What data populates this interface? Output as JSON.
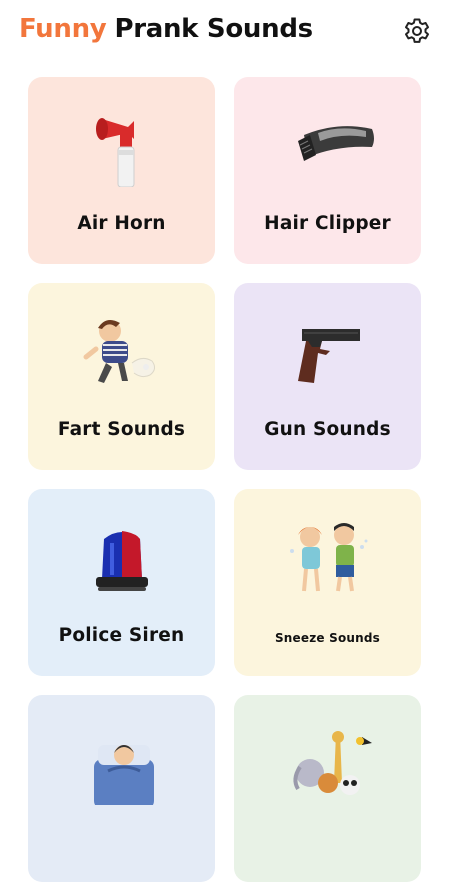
{
  "header": {
    "title_accent": "Funny",
    "title_rest": "Prank Sounds",
    "accent_color": "#f2763c",
    "settings_icon": "gear-icon"
  },
  "sounds": [
    {
      "label": "Air Horn",
      "icon": "air-horn-icon",
      "bg": "#fde5dc"
    },
    {
      "label": "Hair Clipper",
      "icon": "hair-clipper-icon",
      "bg": "#fde7ea"
    },
    {
      "label": "Fart Sounds",
      "icon": "fart-boy-icon",
      "bg": "#fcf5dd"
    },
    {
      "label": "Gun Sounds",
      "icon": "pistol-icon",
      "bg": "#ebe4f6"
    },
    {
      "label": "Police Siren",
      "icon": "police-siren-icon",
      "bg": "#e3eef9"
    },
    {
      "label": "Sneeze Sounds",
      "icon": "sneezing-kids-icon",
      "bg": "#fcf5dd"
    },
    {
      "label": "",
      "icon": "sleeping-man-icon",
      "bg": "#e4ebf6"
    },
    {
      "label": "",
      "icon": "animals-icon",
      "bg": "#e8f2e6"
    }
  ]
}
